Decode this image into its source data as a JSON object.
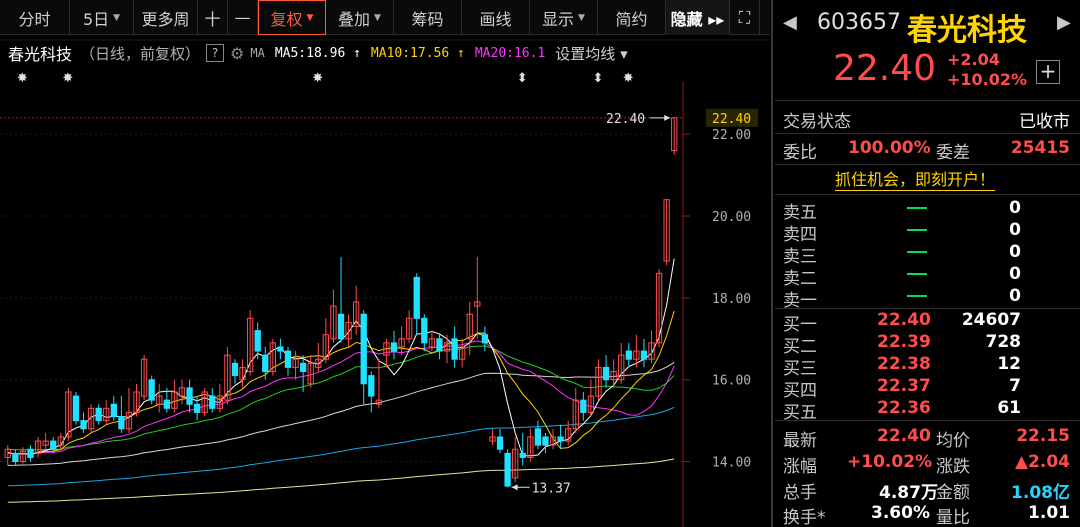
{
  "toolbar": {
    "items": [
      {
        "label": "分时",
        "caret": false,
        "name": "tab-timeshare",
        "w": 70
      },
      {
        "label": "5日",
        "caret": true,
        "name": "tab-5day",
        "w": 64
      },
      {
        "label": "更多周",
        "caret": false,
        "name": "tab-more-period",
        "w": 64
      },
      {
        "label": "十",
        "caret": false,
        "name": "crosshair-button",
        "w": 30
      },
      {
        "label": "—",
        "caret": false,
        "name": "minus-button",
        "w": 30
      },
      {
        "label": "复权",
        "caret": true,
        "name": "adjust-dropdown",
        "w": 68,
        "active": true
      },
      {
        "label": "叠加",
        "caret": true,
        "name": "overlay-dropdown",
        "w": 68
      },
      {
        "label": "筹码",
        "caret": false,
        "name": "chips-button",
        "w": 68
      },
      {
        "label": "画线",
        "caret": false,
        "name": "draw-line-button",
        "w": 68
      },
      {
        "label": "显示",
        "caret": true,
        "name": "display-dropdown",
        "w": 68
      },
      {
        "label": "简约",
        "caret": false,
        "name": "simple-button",
        "w": 68
      },
      {
        "label": "隐藏 ▸▸",
        "caret": false,
        "name": "hide-button",
        "w": 64,
        "hide": true
      },
      {
        "label": "⛶",
        "caret": false,
        "name": "fullscreen-icon",
        "w": 30
      }
    ]
  },
  "legend": {
    "stock_name": "春光科技",
    "mode": "（日线，前复权）",
    "help": "?",
    "gear": "⚙",
    "ma_label": "MA",
    "ma5": "MA5:18.96 ↑",
    "ma10": "MA10:17.56 ↑",
    "ma20": "MA20:16.1",
    "set_ma": "设置均线 ▾"
  },
  "colors": {
    "up": "#ff4d4d",
    "down": "#22e0ff",
    "ma5": "#ffffff",
    "ma10": "#ffd400",
    "ma20": "#ff33ff",
    "ma30": "#22cc22",
    "ma60": "#1aa6e6",
    "ma120": "#d8d8d8",
    "ma250": "#e6e6a0",
    "highlight": "#ffd400"
  },
  "chart_data": {
    "type": "candlestick",
    "y_ticks": [
      "22.00",
      "20.00",
      "18.00",
      "16.00",
      "14.00"
    ],
    "current_price_label": "22.40",
    "max_annotation": "22.40",
    "min_annotation": "13.37",
    "ylim": [
      12.4,
      23.3
    ],
    "candles": [
      {
        "o": 14.1,
        "c": 14.3,
        "h": 14.4,
        "l": 13.9
      },
      {
        "o": 14.2,
        "c": 14.0,
        "h": 14.3,
        "l": 13.9
      },
      {
        "o": 14.0,
        "c": 14.25,
        "h": 14.35,
        "l": 13.95
      },
      {
        "o": 14.3,
        "c": 14.1,
        "h": 14.4,
        "l": 14.0
      },
      {
        "o": 14.2,
        "c": 14.5,
        "h": 14.6,
        "l": 14.1
      },
      {
        "o": 14.4,
        "c": 14.5,
        "h": 14.7,
        "l": 14.3
      },
      {
        "o": 14.5,
        "c": 14.3,
        "h": 14.6,
        "l": 14.2
      },
      {
        "o": 14.4,
        "c": 14.6,
        "h": 14.7,
        "l": 14.3
      },
      {
        "o": 14.6,
        "c": 15.7,
        "h": 15.8,
        "l": 14.5
      },
      {
        "o": 15.6,
        "c": 15.0,
        "h": 15.7,
        "l": 14.9
      },
      {
        "o": 15.0,
        "c": 14.8,
        "h": 15.2,
        "l": 14.7
      },
      {
        "o": 14.8,
        "c": 15.3,
        "h": 15.4,
        "l": 14.7
      },
      {
        "o": 15.3,
        "c": 15.0,
        "h": 15.4,
        "l": 14.9
      },
      {
        "o": 15.0,
        "c": 15.3,
        "h": 15.5,
        "l": 14.9
      },
      {
        "o": 15.4,
        "c": 15.1,
        "h": 15.6,
        "l": 15.0
      },
      {
        "o": 15.1,
        "c": 14.8,
        "h": 15.6,
        "l": 14.7
      },
      {
        "o": 14.8,
        "c": 15.2,
        "h": 15.8,
        "l": 14.7
      },
      {
        "o": 15.2,
        "c": 15.7,
        "h": 15.9,
        "l": 15.1
      },
      {
        "o": 15.6,
        "c": 16.5,
        "h": 16.6,
        "l": 15.5
      },
      {
        "o": 16.0,
        "c": 15.5,
        "h": 16.1,
        "l": 15.4
      },
      {
        "o": 15.4,
        "c": 15.6,
        "h": 15.9,
        "l": 15.2
      },
      {
        "o": 15.5,
        "c": 15.3,
        "h": 15.8,
        "l": 15.2
      },
      {
        "o": 15.3,
        "c": 15.7,
        "h": 16.0,
        "l": 15.2
      },
      {
        "o": 15.6,
        "c": 15.8,
        "h": 16.0,
        "l": 15.4
      },
      {
        "o": 15.8,
        "c": 15.4,
        "h": 16.0,
        "l": 15.2
      },
      {
        "o": 15.4,
        "c": 15.2,
        "h": 15.6,
        "l": 15.0
      },
      {
        "o": 15.2,
        "c": 15.7,
        "h": 15.8,
        "l": 15.1
      },
      {
        "o": 15.6,
        "c": 15.3,
        "h": 15.8,
        "l": 15.2
      },
      {
        "o": 15.3,
        "c": 15.6,
        "h": 15.9,
        "l": 15.2
      },
      {
        "o": 15.5,
        "c": 16.6,
        "h": 16.8,
        "l": 15.4
      },
      {
        "o": 16.4,
        "c": 16.1,
        "h": 16.5,
        "l": 15.9
      },
      {
        "o": 16.0,
        "c": 16.3,
        "h": 16.5,
        "l": 15.8
      },
      {
        "o": 16.2,
        "c": 17.5,
        "h": 17.7,
        "l": 16.1
      },
      {
        "o": 17.2,
        "c": 16.7,
        "h": 17.4,
        "l": 16.5
      },
      {
        "o": 16.6,
        "c": 16.2,
        "h": 16.8,
        "l": 16.0
      },
      {
        "o": 16.2,
        "c": 16.9,
        "h": 17.0,
        "l": 16.1
      },
      {
        "o": 16.8,
        "c": 16.7,
        "h": 17.0,
        "l": 16.5
      },
      {
        "o": 16.7,
        "c": 16.3,
        "h": 16.8,
        "l": 16.1
      },
      {
        "o": 16.3,
        "c": 16.5,
        "h": 16.7,
        "l": 16.0
      },
      {
        "o": 16.4,
        "c": 16.2,
        "h": 16.6,
        "l": 15.7
      },
      {
        "o": 15.9,
        "c": 16.4,
        "h": 16.6,
        "l": 15.8
      },
      {
        "o": 16.3,
        "c": 16.5,
        "h": 16.9,
        "l": 16.2
      },
      {
        "o": 16.5,
        "c": 17.1,
        "h": 17.5,
        "l": 16.4
      },
      {
        "o": 17.0,
        "c": 17.8,
        "h": 18.2,
        "l": 16.9
      },
      {
        "o": 17.6,
        "c": 17.0,
        "h": 19.0,
        "l": 16.9
      },
      {
        "o": 17.0,
        "c": 17.4,
        "h": 17.6,
        "l": 16.8
      },
      {
        "o": 17.3,
        "c": 17.9,
        "h": 18.3,
        "l": 17.1
      },
      {
        "o": 17.6,
        "c": 15.9,
        "h": 17.7,
        "l": 15.4
      },
      {
        "o": 16.1,
        "c": 15.6,
        "h": 16.2,
        "l": 15.2
      },
      {
        "o": 15.4,
        "c": 15.5,
        "h": 16.5,
        "l": 15.3
      },
      {
        "o": 16.6,
        "c": 16.9,
        "h": 17.0,
        "l": 16.3
      },
      {
        "o": 16.9,
        "c": 16.7,
        "h": 17.2,
        "l": 16.5
      },
      {
        "o": 16.8,
        "c": 17.0,
        "h": 17.3,
        "l": 16.6
      },
      {
        "o": 17.0,
        "c": 17.5,
        "h": 17.7,
        "l": 16.9
      },
      {
        "o": 18.5,
        "c": 17.5,
        "h": 18.6,
        "l": 17.1
      },
      {
        "o": 17.5,
        "c": 16.9,
        "h": 17.6,
        "l": 16.7
      },
      {
        "o": 16.8,
        "c": 17.0,
        "h": 17.2,
        "l": 16.7
      },
      {
        "o": 17.0,
        "c": 16.7,
        "h": 17.1,
        "l": 16.5
      },
      {
        "o": 16.7,
        "c": 16.9,
        "h": 17.1,
        "l": 16.4
      },
      {
        "o": 17.0,
        "c": 16.5,
        "h": 17.3,
        "l": 16.3
      },
      {
        "o": 16.5,
        "c": 16.8,
        "h": 17.0,
        "l": 16.3
      },
      {
        "o": 17.0,
        "c": 17.6,
        "h": 17.9,
        "l": 16.6
      },
      {
        "o": 17.8,
        "c": 17.9,
        "h": 19.0,
        "l": 17.0
      },
      {
        "o": 17.1,
        "c": 16.9,
        "h": 17.3,
        "l": 16.7
      },
      {
        "o": 14.5,
        "c": 14.6,
        "h": 14.8,
        "l": 14.4
      },
      {
        "o": 14.6,
        "c": 14.3,
        "h": 14.8,
        "l": 14.2
      },
      {
        "o": 14.2,
        "c": 13.4,
        "h": 14.3,
        "l": 13.37
      },
      {
        "o": 13.6,
        "c": 14.3,
        "h": 14.6,
        "l": 13.5
      },
      {
        "o": 14.2,
        "c": 14.1,
        "h": 14.7,
        "l": 13.9
      },
      {
        "o": 14.1,
        "c": 14.6,
        "h": 14.8,
        "l": 14.0
      },
      {
        "o": 14.8,
        "c": 14.4,
        "h": 15.0,
        "l": 14.3
      },
      {
        "o": 14.6,
        "c": 14.4,
        "h": 14.7,
        "l": 14.2
      },
      {
        "o": 14.4,
        "c": 14.6,
        "h": 14.8,
        "l": 14.3
      },
      {
        "o": 14.6,
        "c": 14.5,
        "h": 14.9,
        "l": 14.3
      },
      {
        "o": 14.5,
        "c": 14.8,
        "h": 15.0,
        "l": 14.4
      },
      {
        "o": 14.8,
        "c": 15.5,
        "h": 15.8,
        "l": 14.7
      },
      {
        "o": 15.5,
        "c": 15.2,
        "h": 15.7,
        "l": 15.0
      },
      {
        "o": 15.2,
        "c": 15.6,
        "h": 16.0,
        "l": 15.1
      },
      {
        "o": 15.6,
        "c": 16.3,
        "h": 16.5,
        "l": 15.5
      },
      {
        "o": 16.3,
        "c": 16.0,
        "h": 16.6,
        "l": 15.8
      },
      {
        "o": 16.0,
        "c": 16.2,
        "h": 16.5,
        "l": 15.8
      },
      {
        "o": 16.0,
        "c": 16.6,
        "h": 16.9,
        "l": 15.9
      },
      {
        "o": 16.7,
        "c": 16.5,
        "h": 16.9,
        "l": 16.3
      },
      {
        "o": 16.5,
        "c": 16.7,
        "h": 17.1,
        "l": 16.3
      },
      {
        "o": 16.7,
        "c": 16.5,
        "h": 17.0,
        "l": 16.3
      },
      {
        "o": 16.5,
        "c": 16.9,
        "h": 17.2,
        "l": 16.4
      },
      {
        "o": 16.9,
        "c": 18.6,
        "h": 18.7,
        "l": 16.8
      },
      {
        "o": 18.9,
        "c": 20.4,
        "h": 20.4,
        "l": 18.8
      },
      {
        "o": 21.6,
        "c": 22.4,
        "h": 22.4,
        "l": 21.5
      }
    ],
    "markers": [
      {
        "index": 2,
        "glyph": "✸"
      },
      {
        "index": 8,
        "glyph": "✸"
      },
      {
        "index": 41,
        "glyph": "✸"
      },
      {
        "index": 68,
        "glyph": "⬍"
      },
      {
        "index": 78,
        "glyph": "⬍"
      },
      {
        "index": 82,
        "glyph": "✸"
      }
    ]
  },
  "quote": {
    "code": "603657",
    "name": "春光科技",
    "price": "22.40",
    "change": "+2.04",
    "change_pct": "+10.02%",
    "plus": "+",
    "nav_prev": "◀",
    "nav_next": "▶",
    "status_label": "交易状态",
    "status_value": "已收市",
    "wb_label": "委比",
    "wb_value": "100.00%",
    "wc_label": "委差",
    "wc_value": "25415",
    "promo": "抓住机会，即刻开户！",
    "asks": [
      {
        "label": "卖五",
        "price": "",
        "vol": "0"
      },
      {
        "label": "卖四",
        "price": "",
        "vol": "0"
      },
      {
        "label": "卖三",
        "price": "",
        "vol": "0"
      },
      {
        "label": "卖二",
        "price": "",
        "vol": "0"
      },
      {
        "label": "卖一",
        "price": "",
        "vol": "0"
      }
    ],
    "bids": [
      {
        "label": "买一",
        "price": "22.40",
        "vol": "24607"
      },
      {
        "label": "买二",
        "price": "22.39",
        "vol": "728"
      },
      {
        "label": "买三",
        "price": "22.38",
        "vol": "12"
      },
      {
        "label": "买四",
        "price": "22.37",
        "vol": "7"
      },
      {
        "label": "买五",
        "price": "22.36",
        "vol": "61"
      }
    ],
    "stats": {
      "latest_label": "最新",
      "latest": "22.40",
      "avg_label": "均价",
      "avg": "22.15",
      "pct_label": "涨幅",
      "pct": "+10.02%",
      "diff_label": "涨跌",
      "diff": "▲2.04",
      "vol_label": "总手",
      "vol": "4.87万",
      "amt_label": "金额",
      "amt": "1.08亿",
      "turn_label": "换手*",
      "turn": "3.60%",
      "ratio_label": "量比",
      "ratio": "1.01"
    }
  }
}
